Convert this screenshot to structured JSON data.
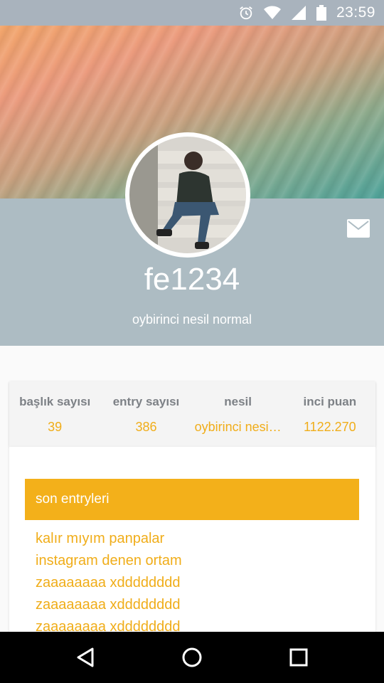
{
  "status_bar": {
    "time": "23:59",
    "icons": [
      "alarm-icon",
      "wifi-icon",
      "signal-icon",
      "battery-icon"
    ]
  },
  "profile": {
    "username": "fe1234",
    "rank": "oybirinci nesil normal",
    "avatar": "profile-photo",
    "message_icon": "mail-icon"
  },
  "stats": [
    {
      "label": "başlık sayısı",
      "value": "39"
    },
    {
      "label": "entry sayısı",
      "value": "386"
    },
    {
      "label": "nesil",
      "value": "oybirinci nesi…"
    },
    {
      "label": "inci puan",
      "value": "1122.270"
    }
  ],
  "recent": {
    "title": "son entryleri",
    "entries": [
      "kalır mıyım panpalar",
      "instagram denen ortam",
      "zaaaaaaaa xdddddddd",
      "zaaaaaaaa xdddddddd",
      "zaaaaaaaa xdddddddd"
    ]
  },
  "nav": {
    "back": "back-icon",
    "home": "home-icon",
    "recents": "recents-icon"
  },
  "colors": {
    "accent": "#f3b01a",
    "band": "#adbcc3",
    "stat_label": "#7d8186"
  }
}
